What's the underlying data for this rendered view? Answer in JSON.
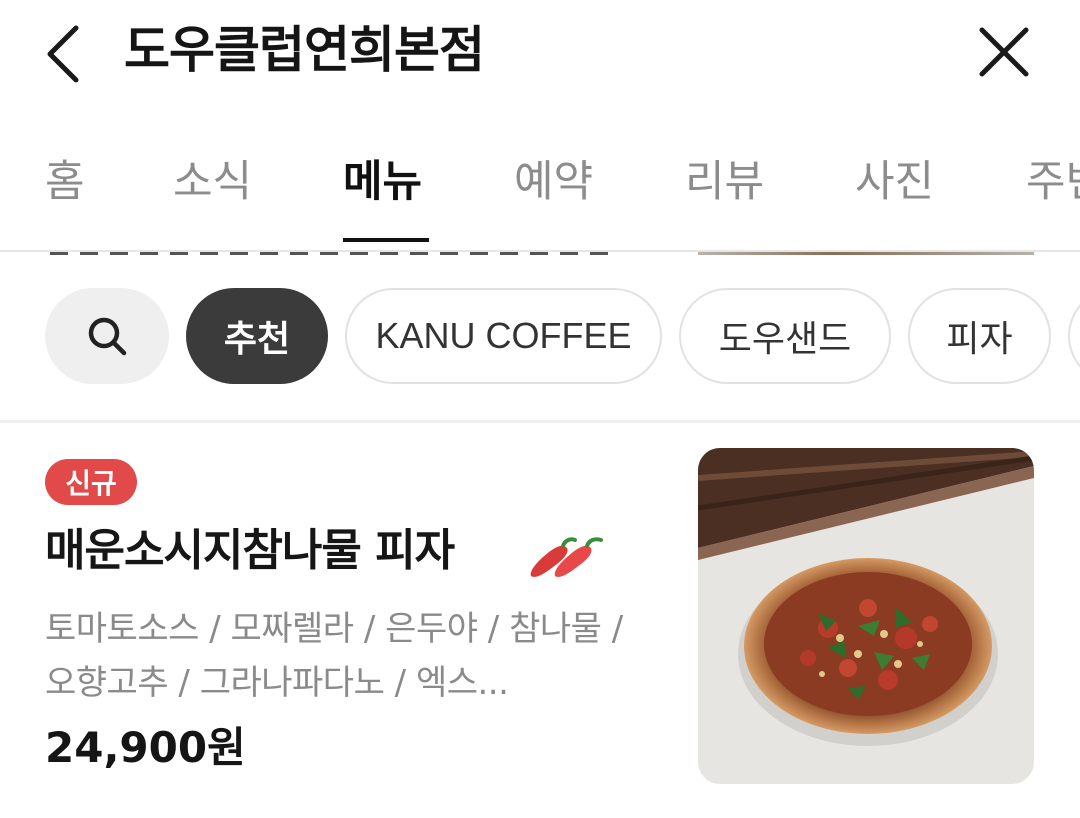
{
  "header": {
    "title": "도우클럽연희본점",
    "back_icon": "chevron-left-icon",
    "close_icon": "close-icon"
  },
  "tabs": [
    {
      "label": "홈",
      "active": false
    },
    {
      "label": "소식",
      "active": false
    },
    {
      "label": "메뉴",
      "active": true
    },
    {
      "label": "예약",
      "active": false
    },
    {
      "label": "리뷰",
      "active": false
    },
    {
      "label": "사진",
      "active": false
    },
    {
      "label": "주변",
      "active": false
    }
  ],
  "filters": {
    "search_icon": "search-icon",
    "chips": [
      {
        "label": "추천",
        "active": true
      },
      {
        "label": "KANU COFFEE",
        "active": false
      },
      {
        "label": "도우샌드",
        "active": false
      },
      {
        "label": "피자",
        "active": false
      }
    ]
  },
  "menu_item": {
    "badge": "신규",
    "name": "매운소시지참나물 피자",
    "spicy_icon": "chili-pepper-icon",
    "description": "토마토소스 / 모짜렐라 / 은두야 / 참나물 / 오향고추 / 그라나파다노 / 엑스...",
    "price": "24,900원",
    "image_icon": "pizza-photo"
  },
  "colors": {
    "accent_badge": "#e24a4a",
    "active_chip": "#3b3b3b",
    "text_primary": "#151515",
    "text_muted": "#8a8a8a"
  }
}
